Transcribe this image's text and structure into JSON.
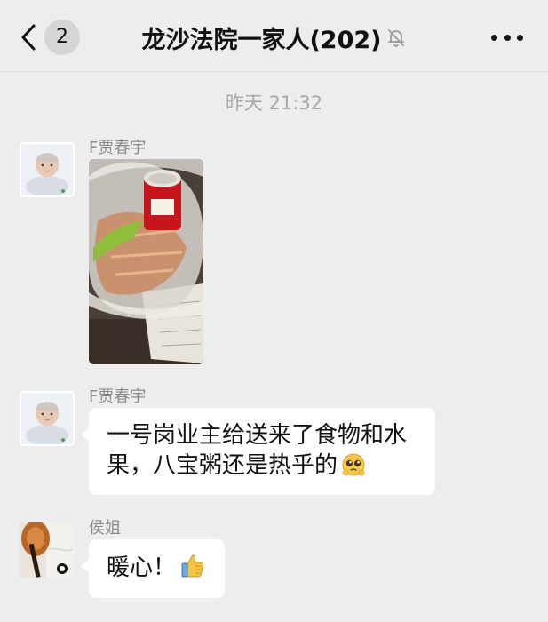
{
  "header": {
    "unread_count": "2",
    "title": "龙沙法院一家人(202)",
    "icons": {
      "back": "chevron-left-icon",
      "mute": "bell-off-icon",
      "more": "more-dots-icon"
    }
  },
  "timestamp": "昨天 21:32",
  "messages": [
    {
      "sender": "F贾春宇",
      "type": "image",
      "avatar": "baby-avatar"
    },
    {
      "sender": "F贾春宇",
      "type": "text",
      "text": "一号岗业主给送来了食物和水果，八宝粥还是热乎的",
      "emoji": "pleading-face-emoji",
      "avatar": "baby-avatar"
    },
    {
      "sender": "侯姐",
      "type": "text",
      "text": "暖心！",
      "emoji": "thumbs-up-emoji",
      "avatar": "violin-avatar"
    }
  ],
  "colors": {
    "background": "#ededed",
    "bubble": "#ffffff",
    "sender_name": "#8a8a8a",
    "timestamp": "#a8a8a8"
  }
}
